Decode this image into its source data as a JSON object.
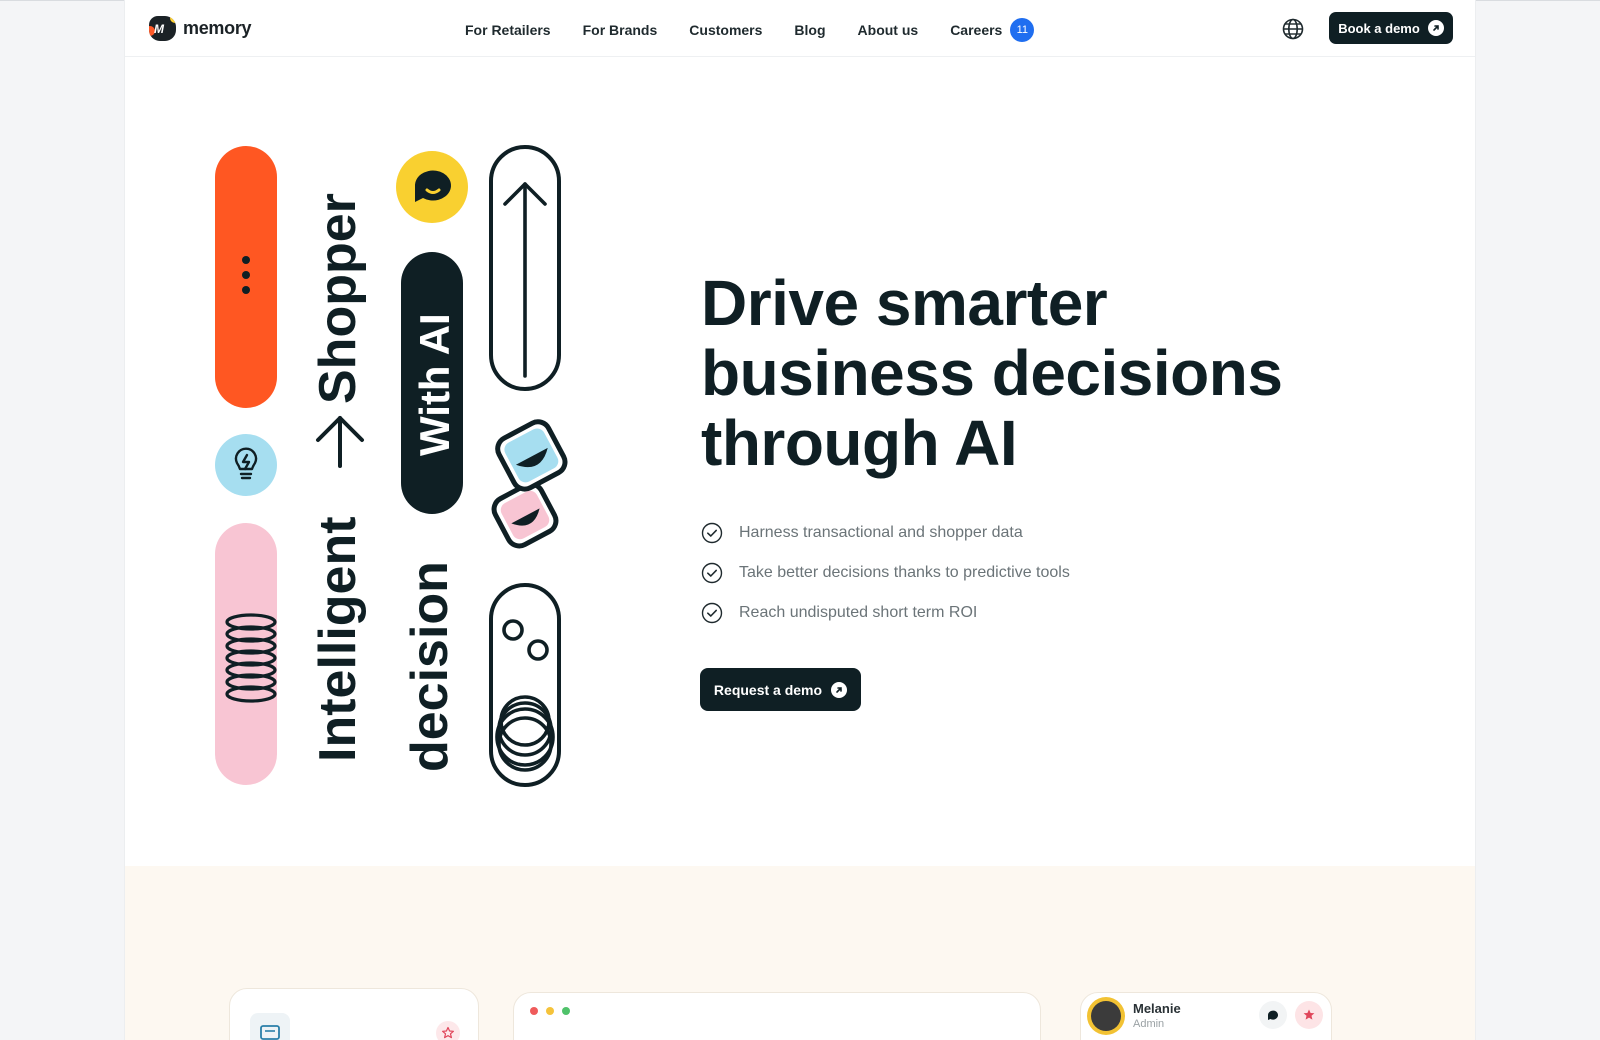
{
  "brand": {
    "name": "memory",
    "mark": "M"
  },
  "nav": {
    "items": [
      {
        "label": "For Retailers"
      },
      {
        "label": "For Brands"
      },
      {
        "label": "Customers"
      },
      {
        "label": "Blog"
      },
      {
        "label": "About us"
      }
    ],
    "careers": {
      "label": "Careers",
      "badge": "11"
    },
    "globe_icon": "globe-icon",
    "cta": "Book a demo"
  },
  "art": {
    "vertical_text_1": "Intelligent",
    "vertical_text_2": "Shopper",
    "vertical_text_3": "decision",
    "pill_text": "With AI",
    "colors": {
      "orange": "#ff5722",
      "blue": "#a6def0",
      "pink": "#f8c5d3",
      "yellow": "#f9d030",
      "dark": "#0f1f24"
    }
  },
  "hero": {
    "headline": "Drive smarter business decisions through AI",
    "features": [
      {
        "text": "Harness transactional and shopper data"
      },
      {
        "text": "Take better decisions thanks to predictive tools"
      },
      {
        "text": "Reach undisputed short term ROI"
      }
    ],
    "cta": "Request a demo"
  },
  "preview": {
    "user": {
      "name": "Melanie",
      "role": "Admin"
    }
  }
}
